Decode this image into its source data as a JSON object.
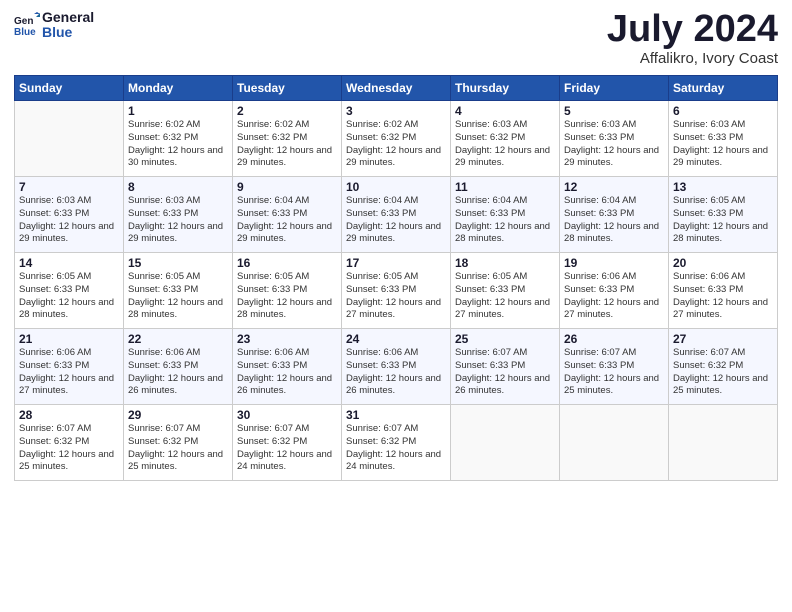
{
  "header": {
    "logo_line1": "General",
    "logo_line2": "Blue",
    "month": "July 2024",
    "location": "Affalikro, Ivory Coast"
  },
  "days_of_week": [
    "Sunday",
    "Monday",
    "Tuesday",
    "Wednesday",
    "Thursday",
    "Friday",
    "Saturday"
  ],
  "weeks": [
    [
      {
        "num": "",
        "sunrise": "",
        "sunset": "",
        "daylight": ""
      },
      {
        "num": "1",
        "sunrise": "Sunrise: 6:02 AM",
        "sunset": "Sunset: 6:32 PM",
        "daylight": "Daylight: 12 hours and 30 minutes."
      },
      {
        "num": "2",
        "sunrise": "Sunrise: 6:02 AM",
        "sunset": "Sunset: 6:32 PM",
        "daylight": "Daylight: 12 hours and 29 minutes."
      },
      {
        "num": "3",
        "sunrise": "Sunrise: 6:02 AM",
        "sunset": "Sunset: 6:32 PM",
        "daylight": "Daylight: 12 hours and 29 minutes."
      },
      {
        "num": "4",
        "sunrise": "Sunrise: 6:03 AM",
        "sunset": "Sunset: 6:32 PM",
        "daylight": "Daylight: 12 hours and 29 minutes."
      },
      {
        "num": "5",
        "sunrise": "Sunrise: 6:03 AM",
        "sunset": "Sunset: 6:33 PM",
        "daylight": "Daylight: 12 hours and 29 minutes."
      },
      {
        "num": "6",
        "sunrise": "Sunrise: 6:03 AM",
        "sunset": "Sunset: 6:33 PM",
        "daylight": "Daylight: 12 hours and 29 minutes."
      }
    ],
    [
      {
        "num": "7",
        "sunrise": "Sunrise: 6:03 AM",
        "sunset": "Sunset: 6:33 PM",
        "daylight": "Daylight: 12 hours and 29 minutes."
      },
      {
        "num": "8",
        "sunrise": "Sunrise: 6:03 AM",
        "sunset": "Sunset: 6:33 PM",
        "daylight": "Daylight: 12 hours and 29 minutes."
      },
      {
        "num": "9",
        "sunrise": "Sunrise: 6:04 AM",
        "sunset": "Sunset: 6:33 PM",
        "daylight": "Daylight: 12 hours and 29 minutes."
      },
      {
        "num": "10",
        "sunrise": "Sunrise: 6:04 AM",
        "sunset": "Sunset: 6:33 PM",
        "daylight": "Daylight: 12 hours and 29 minutes."
      },
      {
        "num": "11",
        "sunrise": "Sunrise: 6:04 AM",
        "sunset": "Sunset: 6:33 PM",
        "daylight": "Daylight: 12 hours and 28 minutes."
      },
      {
        "num": "12",
        "sunrise": "Sunrise: 6:04 AM",
        "sunset": "Sunset: 6:33 PM",
        "daylight": "Daylight: 12 hours and 28 minutes."
      },
      {
        "num": "13",
        "sunrise": "Sunrise: 6:05 AM",
        "sunset": "Sunset: 6:33 PM",
        "daylight": "Daylight: 12 hours and 28 minutes."
      }
    ],
    [
      {
        "num": "14",
        "sunrise": "Sunrise: 6:05 AM",
        "sunset": "Sunset: 6:33 PM",
        "daylight": "Daylight: 12 hours and 28 minutes."
      },
      {
        "num": "15",
        "sunrise": "Sunrise: 6:05 AM",
        "sunset": "Sunset: 6:33 PM",
        "daylight": "Daylight: 12 hours and 28 minutes."
      },
      {
        "num": "16",
        "sunrise": "Sunrise: 6:05 AM",
        "sunset": "Sunset: 6:33 PM",
        "daylight": "Daylight: 12 hours and 28 minutes."
      },
      {
        "num": "17",
        "sunrise": "Sunrise: 6:05 AM",
        "sunset": "Sunset: 6:33 PM",
        "daylight": "Daylight: 12 hours and 27 minutes."
      },
      {
        "num": "18",
        "sunrise": "Sunrise: 6:05 AM",
        "sunset": "Sunset: 6:33 PM",
        "daylight": "Daylight: 12 hours and 27 minutes."
      },
      {
        "num": "19",
        "sunrise": "Sunrise: 6:06 AM",
        "sunset": "Sunset: 6:33 PM",
        "daylight": "Daylight: 12 hours and 27 minutes."
      },
      {
        "num": "20",
        "sunrise": "Sunrise: 6:06 AM",
        "sunset": "Sunset: 6:33 PM",
        "daylight": "Daylight: 12 hours and 27 minutes."
      }
    ],
    [
      {
        "num": "21",
        "sunrise": "Sunrise: 6:06 AM",
        "sunset": "Sunset: 6:33 PM",
        "daylight": "Daylight: 12 hours and 27 minutes."
      },
      {
        "num": "22",
        "sunrise": "Sunrise: 6:06 AM",
        "sunset": "Sunset: 6:33 PM",
        "daylight": "Daylight: 12 hours and 26 minutes."
      },
      {
        "num": "23",
        "sunrise": "Sunrise: 6:06 AM",
        "sunset": "Sunset: 6:33 PM",
        "daylight": "Daylight: 12 hours and 26 minutes."
      },
      {
        "num": "24",
        "sunrise": "Sunrise: 6:06 AM",
        "sunset": "Sunset: 6:33 PM",
        "daylight": "Daylight: 12 hours and 26 minutes."
      },
      {
        "num": "25",
        "sunrise": "Sunrise: 6:07 AM",
        "sunset": "Sunset: 6:33 PM",
        "daylight": "Daylight: 12 hours and 26 minutes."
      },
      {
        "num": "26",
        "sunrise": "Sunrise: 6:07 AM",
        "sunset": "Sunset: 6:33 PM",
        "daylight": "Daylight: 12 hours and 25 minutes."
      },
      {
        "num": "27",
        "sunrise": "Sunrise: 6:07 AM",
        "sunset": "Sunset: 6:32 PM",
        "daylight": "Daylight: 12 hours and 25 minutes."
      }
    ],
    [
      {
        "num": "28",
        "sunrise": "Sunrise: 6:07 AM",
        "sunset": "Sunset: 6:32 PM",
        "daylight": "Daylight: 12 hours and 25 minutes."
      },
      {
        "num": "29",
        "sunrise": "Sunrise: 6:07 AM",
        "sunset": "Sunset: 6:32 PM",
        "daylight": "Daylight: 12 hours and 25 minutes."
      },
      {
        "num": "30",
        "sunrise": "Sunrise: 6:07 AM",
        "sunset": "Sunset: 6:32 PM",
        "daylight": "Daylight: 12 hours and 24 minutes."
      },
      {
        "num": "31",
        "sunrise": "Sunrise: 6:07 AM",
        "sunset": "Sunset: 6:32 PM",
        "daylight": "Daylight: 12 hours and 24 minutes."
      },
      {
        "num": "",
        "sunrise": "",
        "sunset": "",
        "daylight": ""
      },
      {
        "num": "",
        "sunrise": "",
        "sunset": "",
        "daylight": ""
      },
      {
        "num": "",
        "sunrise": "",
        "sunset": "",
        "daylight": ""
      }
    ]
  ]
}
